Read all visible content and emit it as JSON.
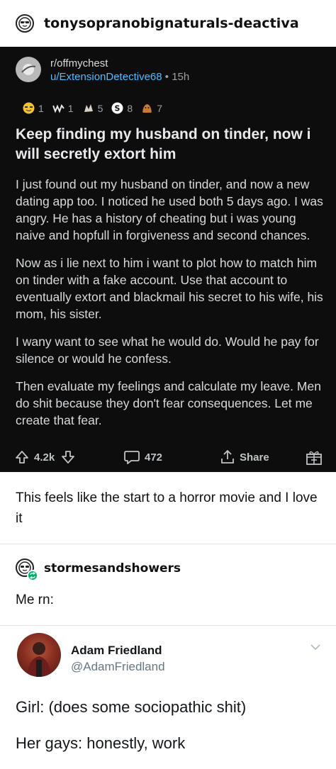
{
  "op": {
    "username": "tonysopranobignaturals-deactiva"
  },
  "reddit": {
    "subreddit": "r/offmychest",
    "user": "u/ExtensionDetective68",
    "separator": "•",
    "age": "15h",
    "awards": [
      {
        "icon": "gold-face-award-icon",
        "count": "1",
        "color": "#f2c230"
      },
      {
        "icon": "wholesome-award-icon",
        "count": "1",
        "color": "#e8e8e8"
      },
      {
        "icon": "hands-award-icon",
        "count": "5",
        "color": "#d7d0c4"
      },
      {
        "icon": "silver-s-award-icon",
        "count": "8",
        "color": "#ffffff"
      },
      {
        "icon": "brown-creature-award-icon",
        "count": "7",
        "color": "#c57a3a"
      }
    ],
    "title": "Keep finding my husband on tinder, now i will secretly extort him",
    "paragraphs": [
      "I just found out my husband on tinder, and now a new dating app too. I noticed he used both 5 days ago. I was angry. He has a history of cheating but i was young naive and hopfull in forgiveness and second chances.",
      "Now as i lie next to him i want to plot how to match him on tinder with a fake account. Use that account to eventually extort and blackmail his secret to his wife, his mom, his sister.",
      "I wany want to see what he would do. Would he pay for silence  or would he confess.",
      "Then evaluate my feelings and calculate my leave. Men do shit because they don't fear consequences. Let me create that fear."
    ],
    "actions": {
      "upvotes": "4.2k",
      "comments": "472",
      "share": "Share"
    }
  },
  "comment_1": "This feels like the start to a horror movie and I love it",
  "reblogger": {
    "username": "stormesandshowers",
    "comment": "Me rn:"
  },
  "tweet": {
    "display_name": "Adam Friedland",
    "handle": "@AdamFriedland",
    "line_1": "Girl: (does some sociopathic shit)",
    "line_2": "Her gays: honestly, work"
  },
  "colors": {
    "reddit_bg": "#0d0d0d",
    "link_blue": "#4fbcff",
    "reblog_green": "#00b36b"
  }
}
